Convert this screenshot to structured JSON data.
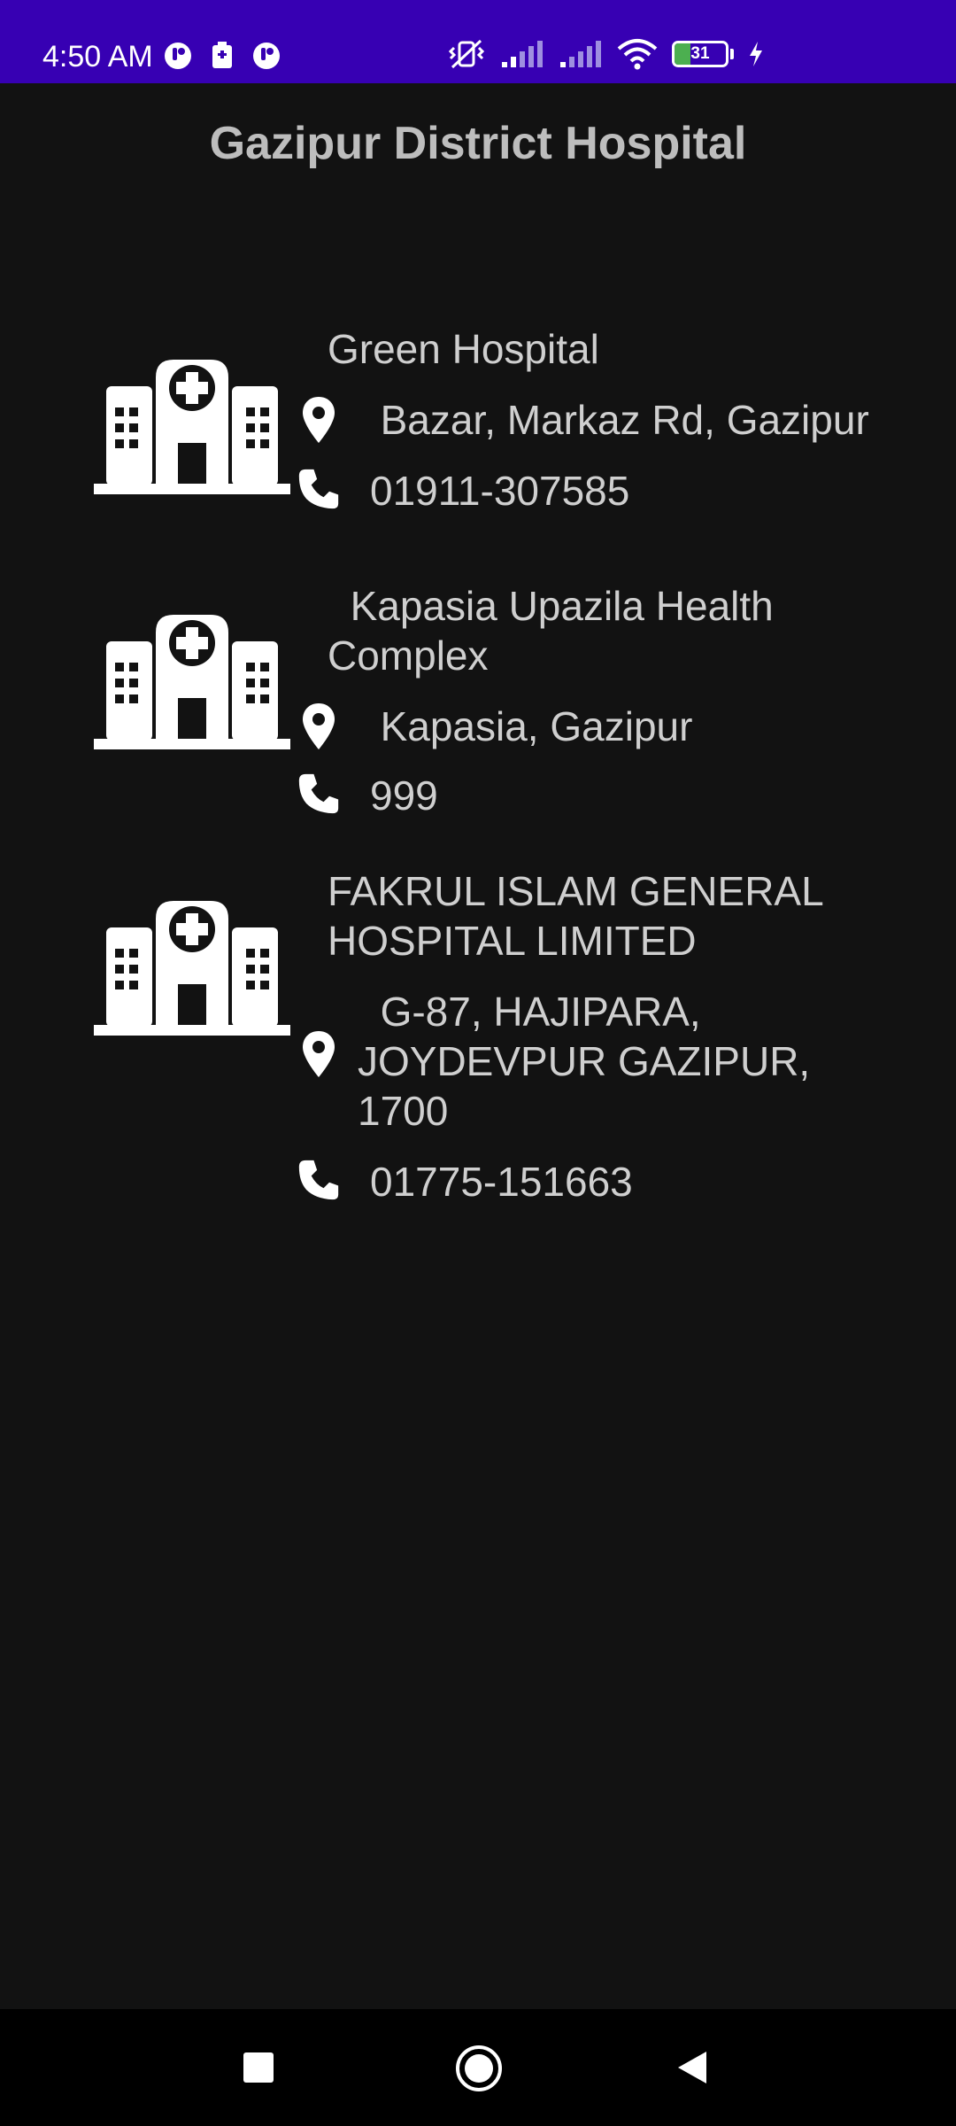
{
  "status_bar": {
    "time": "4:50 AM",
    "battery_level": "31",
    "battery_fraction": 0.31,
    "icons": [
      "notification-app-icon",
      "sim-card-icon",
      "notification-app-icon",
      "vibrate-off-icon",
      "signal-icon",
      "signal-icon",
      "wifi-icon",
      "battery-icon",
      "charging-icon"
    ]
  },
  "header": {
    "title": "Gazipur District Hospital"
  },
  "hospitals": [
    {
      "name": "Green Hospital",
      "address": "  Bazar, Markaz Rd, Gazipur",
      "phone": "01911-307585"
    },
    {
      "name": "  Kapasia Upazila Health\nComplex",
      "address": "  Kapasia, Gazipur",
      "phone": "999"
    },
    {
      "name": "FAKRUL ISLAM GENERAL\nHOSPITAL LIMITED",
      "address": "  G-87, HAJIPARA,\nJOYDEVPUR GAZIPUR,\n1700",
      "phone": "01775-151663"
    }
  ],
  "nav_bar": {
    "buttons": [
      "recents-square-icon",
      "home-circle-icon",
      "back-triangle-icon"
    ]
  },
  "colors": {
    "status_bar": "#3700b3",
    "background": "#121212",
    "text": "#cfcfcf",
    "title": "#bdbdbd",
    "battery_fill": "#4caf50"
  }
}
